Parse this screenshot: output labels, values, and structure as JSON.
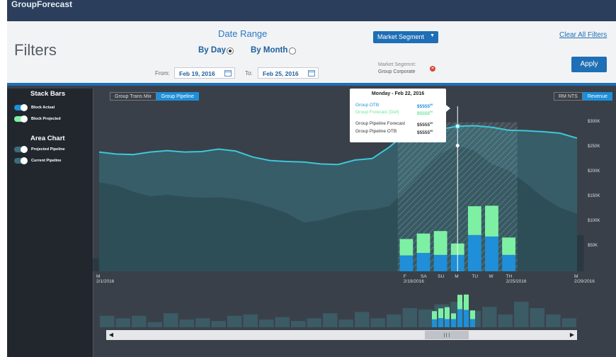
{
  "app": {
    "title": "GroupForecast"
  },
  "filters": {
    "heading": "Filters",
    "date_range": {
      "title": "Date Range",
      "by_day": "By Day",
      "by_month": "By Month",
      "selected": "By Day",
      "from_label": "From:",
      "from_value": "Feb 19, 2016",
      "to_label": "To:",
      "to_value": "Feb 25, 2016"
    },
    "market_segment": {
      "button": "Market Segment",
      "label": "Market Segemnt:",
      "value": "Group Corporate"
    },
    "clear_all": "Clear All Filters",
    "apply": "Apply"
  },
  "sidebar": {
    "stack_bars": {
      "title": "Stack Bars",
      "items": [
        {
          "label": "Block Actual",
          "on": true,
          "color": "#1e8fd8"
        },
        {
          "label": "Block Projected",
          "on": true,
          "color": "#7ef0a4"
        }
      ]
    },
    "area_chart": {
      "title": "Area Chart",
      "items": [
        {
          "label": "Projected Pipeline",
          "on": true,
          "color": "#3c6c7a"
        },
        {
          "label": "Current Pipeline",
          "on": true,
          "color": "#3c6c7a"
        }
      ]
    }
  },
  "chart_tabs": {
    "left": [
      "Group Trans Mix",
      "Group Pipeline"
    ],
    "left_active": 1,
    "right": [
      "RM NTS",
      "Revenue"
    ],
    "right_active": 1
  },
  "tooltip": {
    "date": "Monday - Feb 22, 2016",
    "rows": [
      {
        "label": "Group OTB",
        "value": "$5555",
        "sup": "00",
        "color": "#1e8fd8"
      },
      {
        "label": "Group Forecast (Def)",
        "value": "$5555",
        "sup": "00",
        "color": "#6fe39a"
      },
      {
        "label": "Group Pipeline Forecast",
        "value": "$5555",
        "sup": "00",
        "color": "#333333"
      },
      {
        "label": "Group Pipeline OTB",
        "value": "$5555",
        "sup": "00",
        "color": "#333333"
      }
    ]
  },
  "colors": {
    "accent": "#1e6fb5",
    "otb": "#1e8fd8",
    "forecast": "#7ef0a4",
    "pipeline_line": "#3ec7d9",
    "bg": "#3a4049"
  },
  "chart_data": {
    "type": "bar",
    "ylim": [
      0,
      375
    ],
    "y_ticks": [
      "$300K",
      "$250K",
      "$200K",
      "$150K",
      "$100K",
      "$50K"
    ],
    "y_tick_values": [
      300,
      250,
      200,
      150,
      100,
      50
    ],
    "x_labels": [
      {
        "day": 1,
        "top": "M",
        "bottom": "2/1/2016"
      },
      {
        "day": 19,
        "top": "F",
        "bottom": "2/19/2016"
      },
      {
        "day": 20,
        "top": "SA",
        "bottom": ""
      },
      {
        "day": 21,
        "top": "SU",
        "bottom": ""
      },
      {
        "day": 22,
        "top": "M",
        "bottom": ""
      },
      {
        "day": 23,
        "top": "TU",
        "bottom": ""
      },
      {
        "day": 24,
        "top": "W",
        "bottom": ""
      },
      {
        "day": 25,
        "top": "TH",
        "bottom": "2/25/2016"
      },
      {
        "day": 29,
        "top": "M",
        "bottom": "2/29/2016"
      }
    ],
    "days": [
      1,
      2,
      3,
      4,
      5,
      6,
      7,
      8,
      9,
      10,
      11,
      12,
      13,
      14,
      15,
      16,
      17,
      18,
      19,
      20,
      21,
      22,
      23,
      24,
      25,
      26,
      27,
      28,
      29
    ],
    "background_bars": [
      26,
      27,
      27,
      22,
      31,
      60,
      60,
      38,
      50,
      40,
      41,
      36,
      40,
      40,
      50,
      68,
      63,
      68,
      40,
      36,
      34,
      33,
      45,
      43,
      60,
      92,
      105,
      70,
      73
    ],
    "highlight_days": [
      19,
      20,
      21,
      22,
      23,
      24,
      25
    ],
    "otb": [
      32,
      37,
      33,
      33,
      73,
      70,
      33
    ],
    "forecast": [
      33,
      39,
      48,
      23,
      58,
      62,
      35
    ],
    "pipeline_projected": [
      240,
      236,
      235,
      240,
      243,
      240,
      241,
      246,
      242,
      230,
      223,
      221,
      220,
      216,
      215,
      224,
      227,
      250,
      279,
      285,
      286,
      292,
      293,
      290,
      284,
      283,
      281,
      278,
      268
    ],
    "pipeline_current": [
      179,
      173,
      160,
      151,
      154,
      150,
      148,
      149,
      146,
      139,
      129,
      117,
      98,
      103,
      113,
      122,
      124,
      131,
      166,
      204,
      237,
      253,
      243,
      216,
      203,
      177,
      149,
      128,
      116
    ],
    "minimap_bars": [
      18,
      14,
      18,
      8,
      22,
      12,
      14,
      10,
      18,
      20,
      12,
      16,
      10,
      14,
      22,
      12,
      24,
      14,
      20,
      30,
      28,
      36,
      40,
      26,
      32,
      20,
      40,
      30,
      20,
      14
    ]
  }
}
